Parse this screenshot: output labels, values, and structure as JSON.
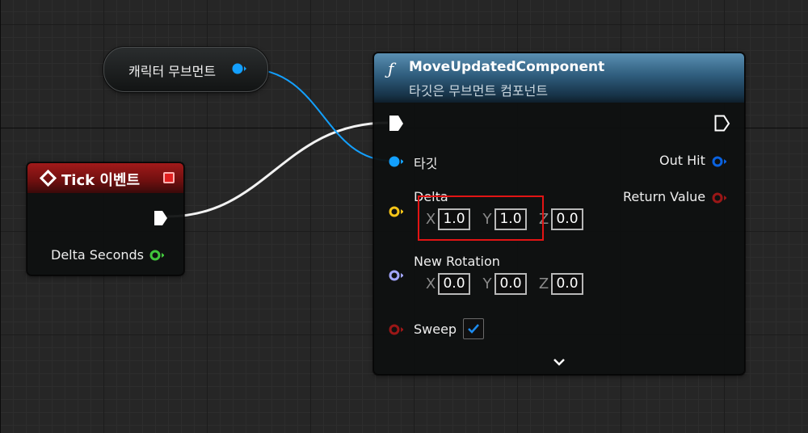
{
  "variable_node": {
    "label": "캐릭터 무브먼트",
    "pin_color": "#13a0ff"
  },
  "event_node": {
    "title": "Tick 이벤트",
    "header_color": "#8f1515",
    "outputs": {
      "delta_seconds_label": "Delta Seconds",
      "delta_seconds_pin_color": "#41c63c"
    }
  },
  "function_node": {
    "icon": "function-icon",
    "icon_glyph": "ƒ",
    "title": "MoveUpdatedComponent",
    "subtitle": "타깃은 무브먼트 컴포넌트",
    "header_color": "#3b6c8d",
    "inputs": {
      "target_label": "타깃",
      "target_pin_color": "#13a0ff",
      "delta": {
        "label": "Delta",
        "pin_color": "#f5c518",
        "x_label": "X",
        "x": "1.0",
        "y_label": "Y",
        "y": "1.0",
        "z_label": "Z",
        "z": "0.0"
      },
      "new_rotation": {
        "label": "New Rotation",
        "pin_color": "#a3a6ff",
        "x_label": "X",
        "x": "0.0",
        "y_label": "Y",
        "y": "0.0",
        "z_label": "Z",
        "z": "0.0"
      },
      "sweep": {
        "label": "Sweep",
        "pin_color": "#9b1717",
        "checked": true,
        "check_color": "#1d8cf0"
      }
    },
    "outputs": {
      "out_hit_label": "Out Hit",
      "out_hit_pin_color": "#0a62e0",
      "return_value_label": "Return Value",
      "return_value_pin_color": "#9b1717"
    },
    "expand_icon": "chevron-down-icon"
  },
  "highlight_color": "#e21414"
}
